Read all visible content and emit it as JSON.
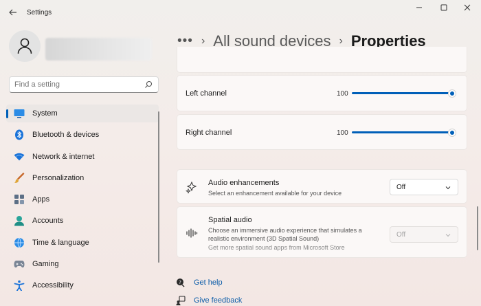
{
  "window": {
    "title": "Settings",
    "controls": [
      "minimize",
      "maximize",
      "close"
    ]
  },
  "search": {
    "placeholder": "Find a setting"
  },
  "nav": {
    "items": [
      {
        "label": "System",
        "icon": "monitor-icon",
        "active": true
      },
      {
        "label": "Bluetooth & devices",
        "icon": "bluetooth-icon",
        "active": false
      },
      {
        "label": "Network & internet",
        "icon": "wifi-icon",
        "active": false
      },
      {
        "label": "Personalization",
        "icon": "brush-icon",
        "active": false
      },
      {
        "label": "Apps",
        "icon": "apps-icon",
        "active": false
      },
      {
        "label": "Accounts",
        "icon": "person-icon",
        "active": false
      },
      {
        "label": "Time & language",
        "icon": "globe-clock-icon",
        "active": false
      },
      {
        "label": "Gaming",
        "icon": "gamepad-icon",
        "active": false
      },
      {
        "label": "Accessibility",
        "icon": "accessibility-icon",
        "active": false
      }
    ]
  },
  "breadcrumb": {
    "more": "•••",
    "parent": "All sound devices",
    "current": "Properties",
    "separator": "›"
  },
  "channels": {
    "left": {
      "label": "Left channel",
      "value": "100",
      "level": 1.0
    },
    "right": {
      "label": "Right channel",
      "value": "100",
      "level": 1.0
    }
  },
  "audio_enhancements": {
    "title": "Audio enhancements",
    "description": "Select an enhancement available for your device",
    "selected": "Off"
  },
  "spatial_audio": {
    "title": "Spatial audio",
    "description": "Choose an immersive audio experience that simulates a realistic environment (3D Spatial Sound)",
    "link": "Get more spatial sound apps from Microsoft Store",
    "selected": "Off",
    "disabled": true
  },
  "footer": {
    "get_help": "Get help",
    "give_feedback": "Give feedback"
  },
  "colors": {
    "accent": "#005fb8",
    "link": "#0a5ca8"
  }
}
